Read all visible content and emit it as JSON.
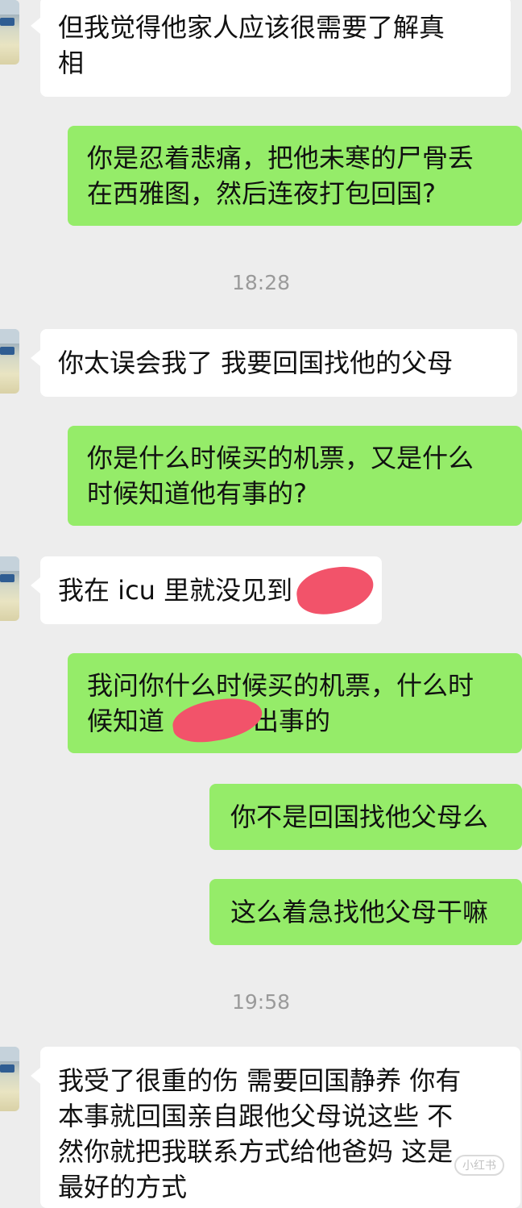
{
  "conversation": {
    "messages": [
      {
        "side": "received",
        "lines": [
          "但我觉得他家人应该很需要了解真",
          "相"
        ]
      },
      {
        "side": "sent",
        "lines": [
          "你是忍着悲痛，把他未寒的尸骨丢",
          "在西雅图，然后连夜打包回国?"
        ]
      },
      {
        "side": "received",
        "lines": [
          "你太误会我了 我要回国找他的父母"
        ]
      },
      {
        "side": "sent",
        "lines": [
          "你是什么时候买的机票，又是什么",
          "时候知道他有事的?"
        ]
      },
      {
        "side": "received",
        "lines": [
          "我在 icu 里就没见到"
        ]
      },
      {
        "side": "sent",
        "lines": [
          "我问你什么时候买的机票，什么时",
          "候知道",
          "出事的"
        ]
      },
      {
        "side": "sent",
        "lines": [
          "你不是回国找他父母么"
        ]
      },
      {
        "side": "sent",
        "lines": [
          "这么着急找他父母干嘛"
        ]
      },
      {
        "side": "received",
        "lines": [
          "我受了很重的伤 需要回国静养 你有",
          "本事就回国亲自跟他父母说这些 不",
          "然你就把我联系方式给他爸妈 这是",
          "最好的方式"
        ]
      }
    ],
    "timestamps": [
      "18:28",
      "19:58"
    ]
  },
  "watermark": "小红书",
  "colors": {
    "sent_bubble": "#95ec69",
    "received_bubble": "#ffffff",
    "background": "#ededed",
    "redaction": "#f2536a"
  }
}
